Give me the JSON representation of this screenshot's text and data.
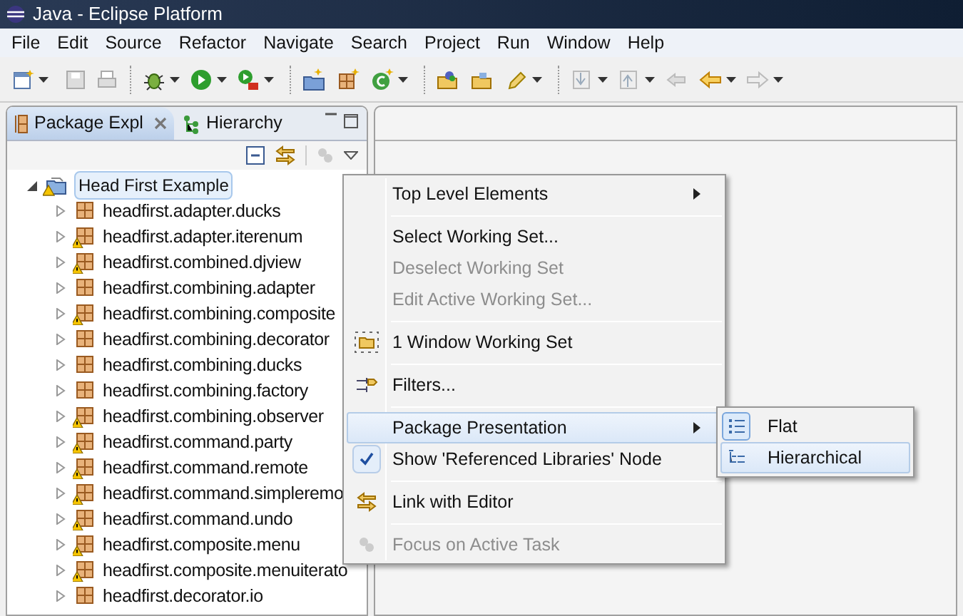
{
  "window": {
    "title": "Java - Eclipse Platform"
  },
  "menu_bar": [
    "File",
    "Edit",
    "Source",
    "Refactor",
    "Navigate",
    "Search",
    "Project",
    "Run",
    "Window",
    "Help"
  ],
  "view_tabs": [
    {
      "label": "Package Expl",
      "selected": true
    },
    {
      "label": "Hierarchy",
      "selected": false
    }
  ],
  "tree": [
    {
      "label": "Head First Example",
      "selected": true,
      "expanded": true,
      "warning": true,
      "children": [
        {
          "label": "headfirst.adapter.ducks",
          "warning": false,
          "expanded": false
        },
        {
          "label": "headfirst.adapter.iterenum",
          "warning": true,
          "expanded": false
        },
        {
          "label": "headfirst.combined.djview",
          "warning": true,
          "expanded": false
        },
        {
          "label": "headfirst.combining.adapter",
          "warning": false,
          "expanded": false
        },
        {
          "label": "headfirst.combining.composite",
          "warning": true,
          "expanded": false
        },
        {
          "label": "headfirst.combining.decorator",
          "warning": false,
          "expanded": false
        },
        {
          "label": "headfirst.combining.ducks",
          "warning": false,
          "expanded": false
        },
        {
          "label": "headfirst.combining.factory",
          "warning": false,
          "expanded": false
        },
        {
          "label": "headfirst.combining.observer",
          "warning": true,
          "expanded": false
        },
        {
          "label": "headfirst.command.party",
          "warning": true,
          "expanded": false
        },
        {
          "label": "headfirst.command.remote",
          "warning": true,
          "expanded": false
        },
        {
          "label": "headfirst.command.simpleremo",
          "warning": true,
          "expanded": false
        },
        {
          "label": "headfirst.command.undo",
          "warning": true,
          "expanded": false
        },
        {
          "label": "headfirst.composite.menu",
          "warning": true,
          "expanded": false
        },
        {
          "label": "headfirst.composite.menuiterato",
          "warning": true,
          "expanded": false
        },
        {
          "label": "headfirst.decorator.io",
          "warning": false,
          "expanded": false
        }
      ]
    }
  ],
  "context_menu": [
    {
      "kind": "item",
      "label": "Top Level Elements",
      "submenu": true,
      "disabled": false,
      "selected": false
    },
    {
      "kind": "separator"
    },
    {
      "kind": "item",
      "label": "Select Working Set...",
      "disabled": false,
      "selected": false
    },
    {
      "kind": "item",
      "label": "Deselect Working Set",
      "disabled": true,
      "selected": false
    },
    {
      "kind": "item",
      "label": "Edit Active Working Set...",
      "disabled": true,
      "selected": false
    },
    {
      "kind": "separator"
    },
    {
      "kind": "item",
      "label": "1 Window Working Set",
      "disabled": false,
      "selected": false
    },
    {
      "kind": "separator"
    },
    {
      "kind": "item",
      "label": "Filters...",
      "disabled": false,
      "selected": false
    },
    {
      "kind": "separator"
    },
    {
      "kind": "item",
      "label": "Package Presentation",
      "submenu": true,
      "disabled": false,
      "selected": true
    },
    {
      "kind": "item",
      "label": "Show 'Referenced Libraries' Node",
      "checked": true,
      "disabled": false,
      "selected": false
    },
    {
      "kind": "separator"
    },
    {
      "kind": "item",
      "label": "Link with Editor",
      "disabled": false,
      "selected": false
    },
    {
      "kind": "separator"
    },
    {
      "kind": "item",
      "label": "Focus on Active Task",
      "disabled": true,
      "selected": false
    }
  ],
  "submenu": [
    {
      "label": "Flat",
      "checked": true,
      "selected": false
    },
    {
      "label": "Hierarchical",
      "checked": false,
      "selected": true
    }
  ]
}
